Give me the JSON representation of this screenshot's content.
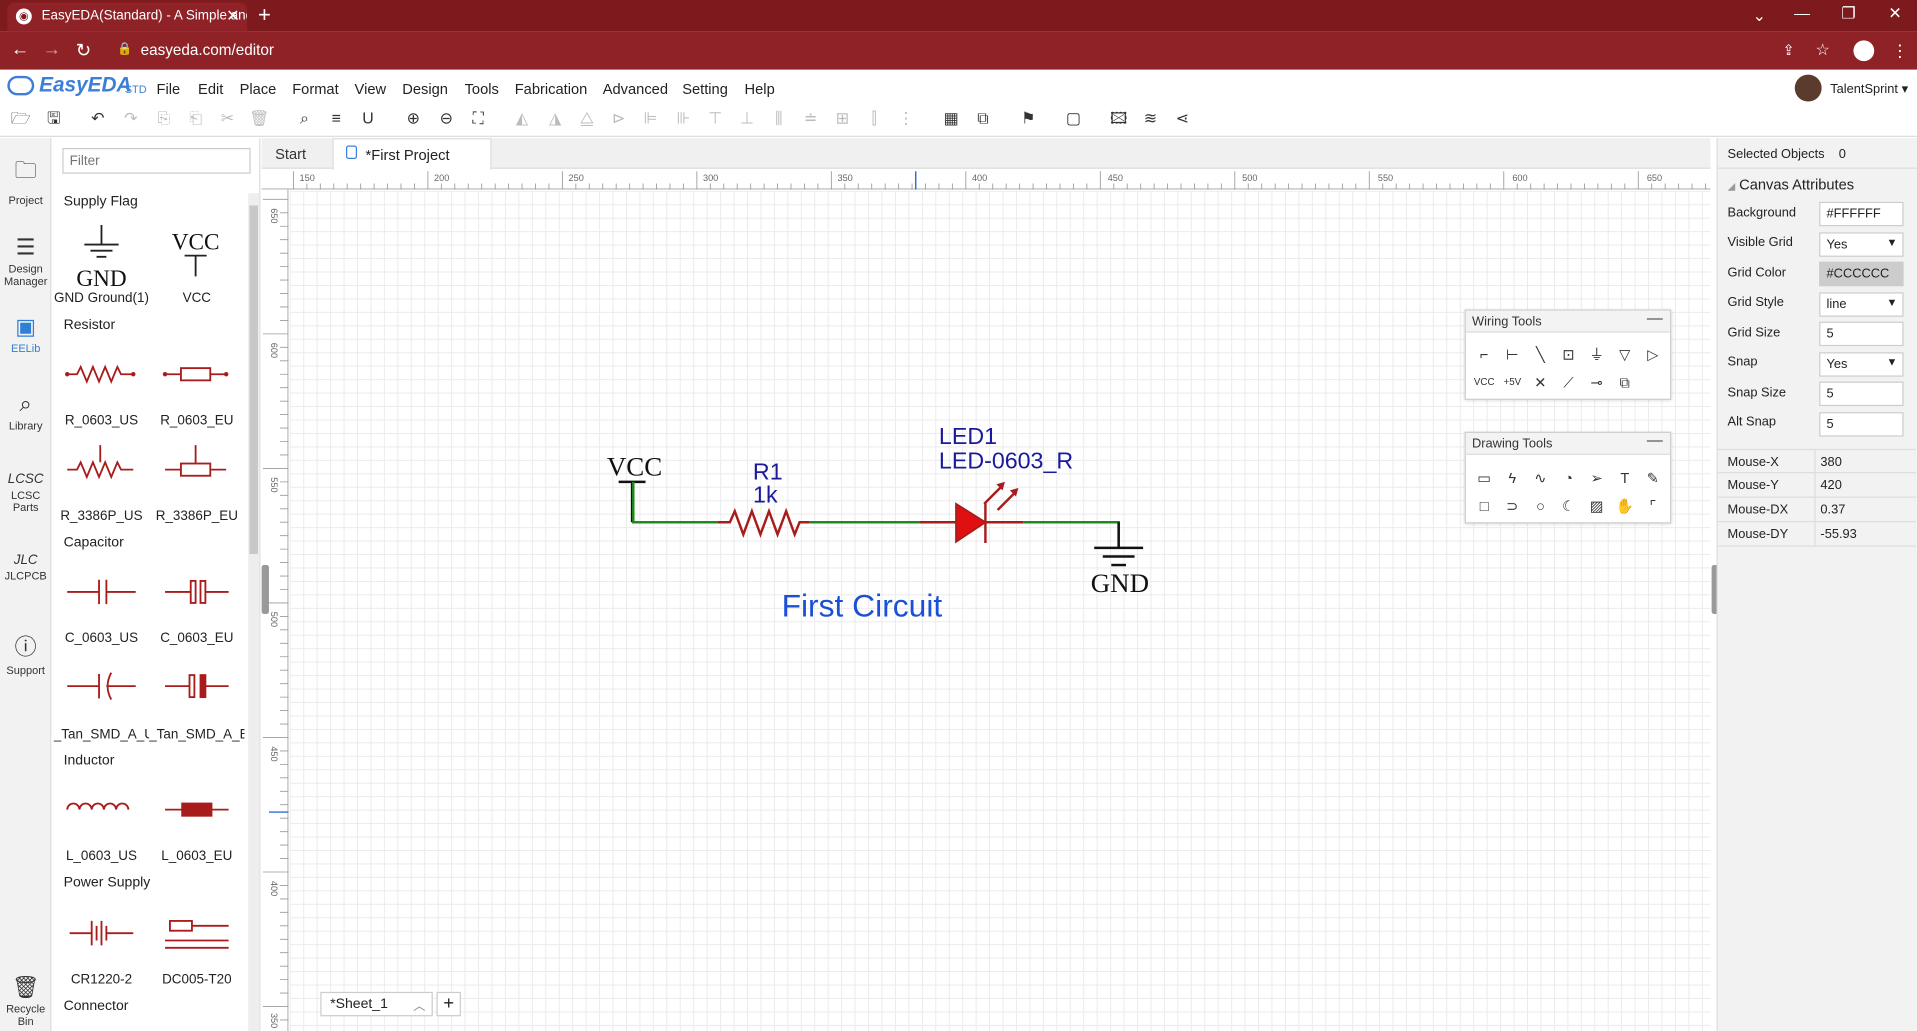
{
  "browser": {
    "tab_title": "EasyEDA(Standard) - A Simple and",
    "url": "easyeda.com/editor"
  },
  "app": {
    "logo": "EasyEDA",
    "logo_suffix": "STD",
    "user": "TalentSprint"
  },
  "menu": [
    "File",
    "Edit",
    "Place",
    "Format",
    "View",
    "Design",
    "Tools",
    "Fabrication",
    "Advanced",
    "Setting",
    "Help"
  ],
  "leftnav": [
    {
      "label": "Project",
      "icon": "folder-icon"
    },
    {
      "label": "Design Manager",
      "icon": "list-icon"
    },
    {
      "label": "EELib",
      "icon": "chip-icon"
    },
    {
      "label": "Library",
      "icon": "search-book-icon"
    },
    {
      "label": "LCSC Parts",
      "icon": "lcsc-icon"
    },
    {
      "label": "JLCPCB",
      "icon": "jlc-icon"
    },
    {
      "label": "Support",
      "icon": "help-icon"
    },
    {
      "label": "Recycle Bin",
      "icon": "trash-icon"
    }
  ],
  "library": {
    "filter_placeholder": "Filter",
    "categories": {
      "supply": "Supply Flag",
      "resistor": "Resistor",
      "capacitor": "Capacitor",
      "inductor": "Inductor",
      "power": "Power Supply",
      "connector": "Connector"
    },
    "parts": {
      "gnd": "GND Ground(1)",
      "vcc": "VCC",
      "r_us": "R_0603_US",
      "r_eu": "R_0603_EU",
      "rp_us": "R_3386P_US",
      "rp_eu": "R_3386P_EU",
      "c_us": "C_0603_US",
      "c_eu": "C_0603_EU",
      "tan_a": "_Tan_SMD_A_U",
      "tan_e": "_Tan_SMD_A_E",
      "l_us": "L_0603_US",
      "l_eu": "L_0603_EU",
      "cr": "CR1220-2",
      "dc": "DC005-T20"
    },
    "symbols": {
      "gnd": "GND",
      "vcc": "VCC"
    }
  },
  "tabs": {
    "start": "Start",
    "project": "*First Project"
  },
  "ruler_h": [
    "150",
    "200",
    "250",
    "300",
    "350",
    "400",
    "450",
    "500",
    "550",
    "600",
    "650"
  ],
  "ruler_v": [
    "650",
    "600",
    "550",
    "500",
    "450",
    "400",
    "350"
  ],
  "schematic": {
    "vcc": "VCC",
    "r_name": "R1",
    "r_value": "1k",
    "led_name": "LED1",
    "led_value": "LED-0603_R",
    "gnd": "GND",
    "title": "First Circuit"
  },
  "wiring_tools": {
    "title": "Wiring Tools"
  },
  "drawing_tools": {
    "title": "Drawing Tools"
  },
  "right_panel": {
    "selected_label": "Selected Objects",
    "selected_value": "0",
    "section": "Canvas Attributes",
    "background_label": "Background",
    "background_value": "#FFFFFF",
    "visible_grid_label": "Visible Grid",
    "visible_grid_value": "Yes",
    "grid_color_label": "Grid Color",
    "grid_color_value": "#CCCCCC",
    "grid_style_label": "Grid Style",
    "grid_style_value": "line",
    "grid_size_label": "Grid Size",
    "grid_size_value": "5",
    "snap_label": "Snap",
    "snap_value": "Yes",
    "snap_size_label": "Snap Size",
    "snap_size_value": "5",
    "alt_snap_label": "Alt Snap",
    "alt_snap_value": "5",
    "mouse": [
      {
        "k": "Mouse-X",
        "v": "380"
      },
      {
        "k": "Mouse-Y",
        "v": "420"
      },
      {
        "k": "Mouse-DX",
        "v": "0.37"
      },
      {
        "k": "Mouse-DY",
        "v": "-55.93"
      }
    ]
  },
  "sheet": {
    "label": "*Sheet_1",
    "add": "+"
  },
  "colors": {
    "wire": "#1f8a1f",
    "part": "#a81c1c",
    "text": "#1a1a9a",
    "title": "#1b4fd6",
    "chrome": "#7d1a1e"
  }
}
